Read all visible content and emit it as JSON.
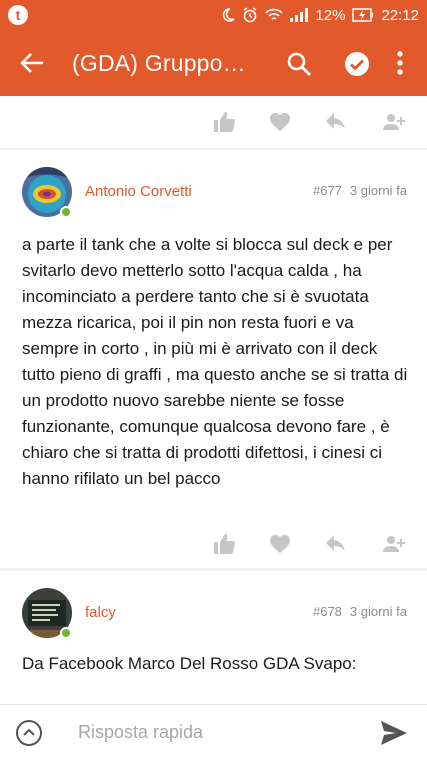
{
  "status_bar": {
    "battery": "12%",
    "time": "22:12"
  },
  "toolbar": {
    "title": "(GDA) Gruppo…"
  },
  "posts": [
    {
      "author": "Antonio Corvetti",
      "number": "#677",
      "time_ago": "3 giorni fa",
      "body": "a parte il tank che a volte si blocca sul deck e per svitarlo devo metterlo sotto l'acqua calda , ha incominciato a perdere tanto che si è svuotata mezza ricarica, poi il pin non resta fuori e va sempre in corto , in più mi è arrivato con il deck tutto pieno di graffi , ma questo anche se si tratta di un prodotto nuovo sarebbe niente se fosse funzionante, comunque qualcosa devono fare , è chiaro che si tratta di prodotti difettosi, i cinesi ci hanno rifilato un bel pacco"
    },
    {
      "author": "falcy",
      "number": "#678",
      "time_ago": "3 giorni fa",
      "body": "Da Facebook Marco Del Rosso GDA Svapo:"
    }
  ],
  "quick_reply": {
    "placeholder": "Risposta rapida"
  },
  "colors": {
    "accent": "#e2592b",
    "online": "#6bb63a",
    "action_icon": "#c6c6c6"
  },
  "icons": [
    "back-arrow-icon",
    "search-icon",
    "check-circle-icon",
    "more-vert-icon",
    "like-icon",
    "heart-icon",
    "reply-icon",
    "add-user-icon",
    "chevron-up-icon",
    "send-icon"
  ]
}
